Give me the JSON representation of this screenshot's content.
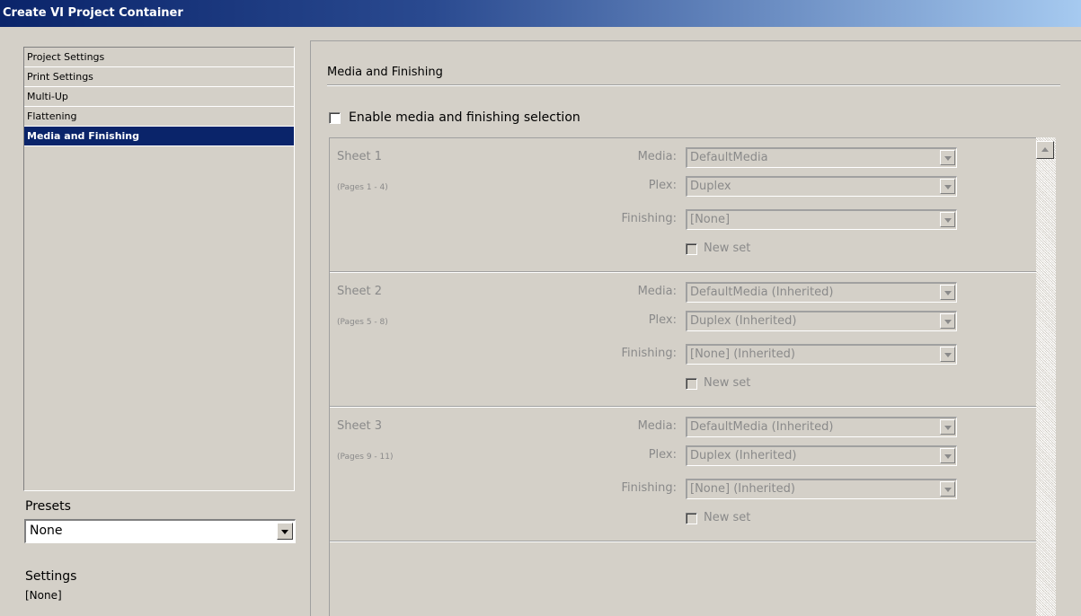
{
  "window": {
    "title": "Create VI Project Container"
  },
  "nav": {
    "items": [
      {
        "label": "Project Settings",
        "active": false
      },
      {
        "label": "Print Settings",
        "active": false
      },
      {
        "label": "Multi-Up",
        "active": false
      },
      {
        "label": "Flattening",
        "active": false
      },
      {
        "label": "Media and Finishing",
        "active": true
      }
    ]
  },
  "presets": {
    "label": "Presets",
    "value": "None"
  },
  "settings": {
    "label": "Settings",
    "value": "[None]"
  },
  "main": {
    "title": "Media and Finishing",
    "enable_label": "Enable media and finishing selection",
    "enable_checked": false
  },
  "field_labels": {
    "media": "Media:",
    "plex": "Plex:",
    "finishing": "Finishing:",
    "new_set": "New set"
  },
  "sheets": [
    {
      "title": "Sheet 1",
      "pages": "(Pages 1 - 4)",
      "media": "DefaultMedia",
      "plex": "Duplex",
      "finishing": "[None]"
    },
    {
      "title": "Sheet 2",
      "pages": "(Pages 5 - 8)",
      "media": "DefaultMedia (Inherited)",
      "plex": "Duplex (Inherited)",
      "finishing": "[None] (Inherited)"
    },
    {
      "title": "Sheet 3",
      "pages": "(Pages 9 - 11)",
      "media": "DefaultMedia (Inherited)",
      "plex": "Duplex (Inherited)",
      "finishing": "[None] (Inherited)"
    }
  ]
}
